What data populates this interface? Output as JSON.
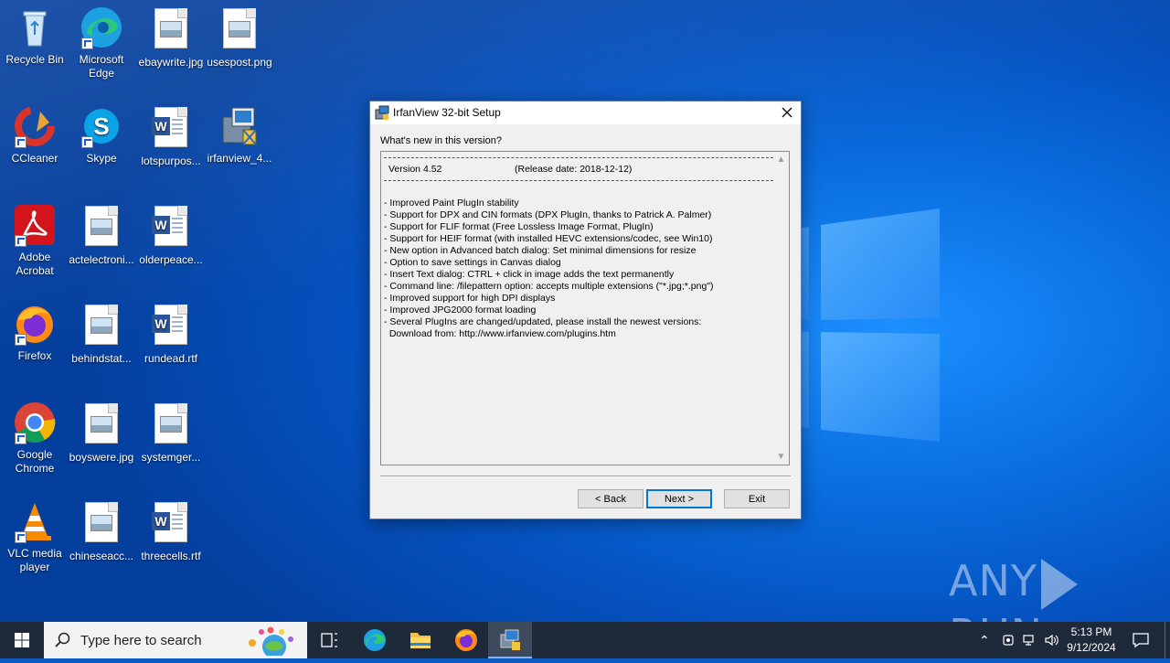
{
  "desktop": {
    "icons": [
      {
        "label": "Recycle Bin"
      },
      {
        "label": "Microsoft Edge"
      },
      {
        "label": "ebaywrite.jpg"
      },
      {
        "label": "usespost.png"
      },
      {
        "label": "CCleaner"
      },
      {
        "label": "Skype"
      },
      {
        "label": "lotspurpos..."
      },
      {
        "label": "irfanview_4..."
      },
      {
        "label": "Adobe Acrobat"
      },
      {
        "label": "actelectroni..."
      },
      {
        "label": "olderpeace..."
      },
      {
        "label": "Firefox"
      },
      {
        "label": "behindstat..."
      },
      {
        "label": "rundead.rtf"
      },
      {
        "label": "Google Chrome"
      },
      {
        "label": "boyswere.jpg"
      },
      {
        "label": "systemger..."
      },
      {
        "label": "VLC media player"
      },
      {
        "label": "chineseacc..."
      },
      {
        "label": "threecells.rtf"
      }
    ],
    "watermark": {
      "left": "ANY",
      "right": "RUN"
    }
  },
  "setup_window": {
    "title": "IrfanView 32-bit Setup",
    "heading": "What's new in this version?",
    "version": "Version 4.52",
    "release_date": "(Release date: 2018-12-12)",
    "changes": [
      "- Improved Paint PlugIn stability",
      "- Support for DPX and CIN formats (DPX PlugIn, thanks to Patrick A. Palmer)",
      "- Support for FLIF format (Free Lossless Image Format, PlugIn)",
      "- Support for HEIF format (with installed HEVC extensions/codec, see Win10)",
      "- New option in Advanced batch dialog: Set minimal dimensions for resize",
      "- Option to save settings in Canvas dialog",
      "- Insert Text dialog: CTRL + click in image adds the text permanently",
      "- Command line: /filepattern option: accepts multiple extensions (\"*.jpg;*.png\")",
      "- Improved support for high DPI displays",
      "- Improved JPG2000 format loading",
      "- Several PlugIns are changed/updated, please install the newest versions:",
      "  Download from: http://www.irfanview.com/plugins.htm"
    ],
    "buttons": {
      "back": "< Back",
      "next": "Next >",
      "exit": "Exit"
    }
  },
  "taskbar": {
    "search_placeholder": "Type here to search",
    "time": "5:13 PM",
    "date": "9/12/2024"
  }
}
